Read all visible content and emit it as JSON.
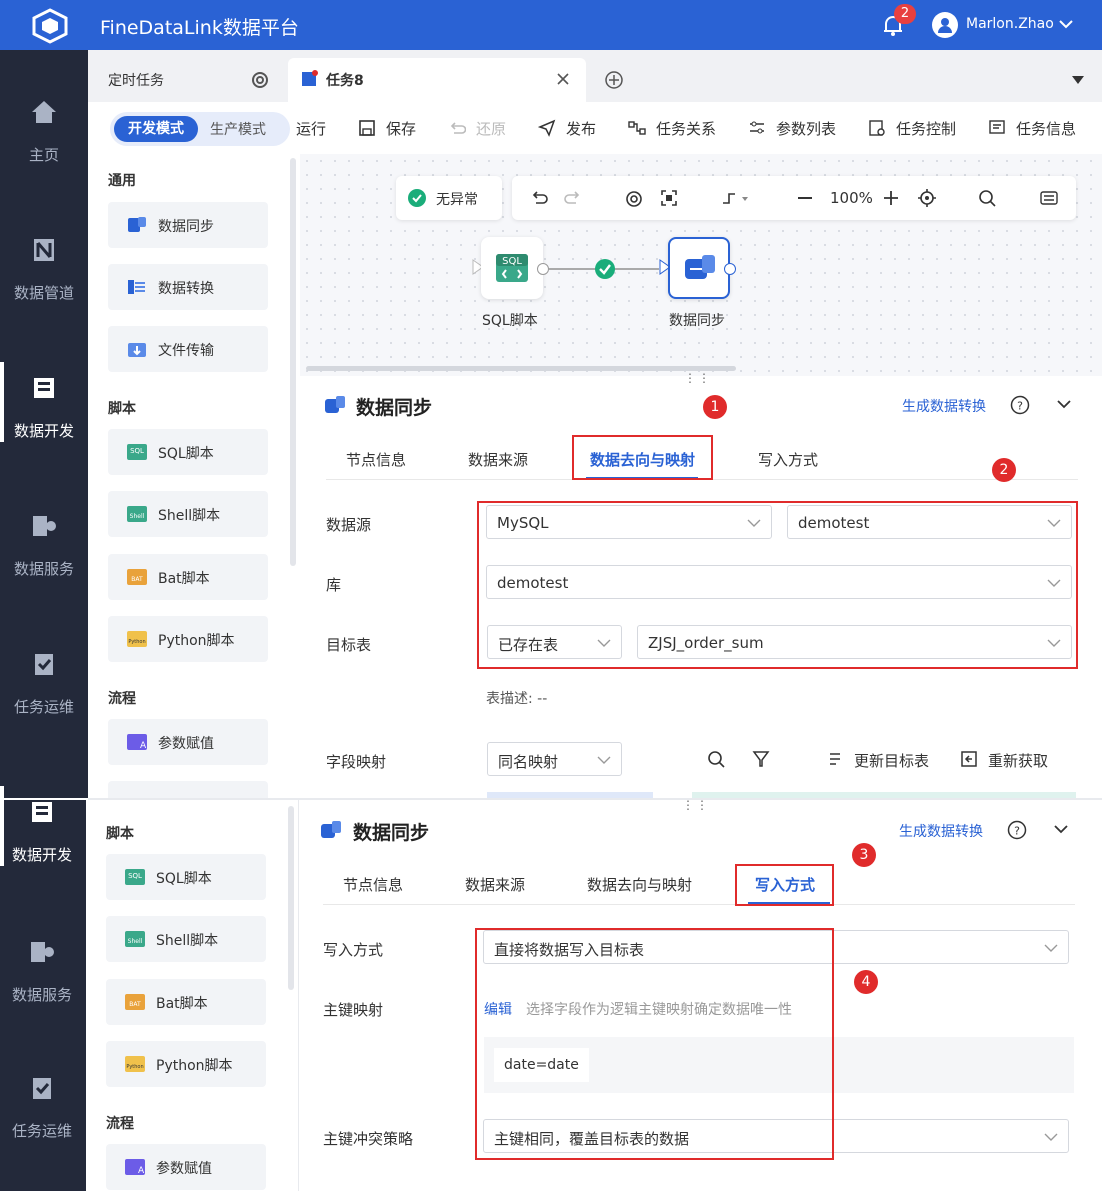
{
  "header": {
    "app_title": "FineDataLink数据平台",
    "notification_count": "2",
    "user_name": "Marlon.Zhao"
  },
  "sidebar_top": {
    "items": [
      {
        "label": "主页",
        "icon": "home-icon"
      },
      {
        "label": "数据管道",
        "icon": "pipeline-icon"
      },
      {
        "label": "数据开发",
        "icon": "dev-icon",
        "active": true
      },
      {
        "label": "数据服务",
        "icon": "service-icon"
      },
      {
        "label": "任务运维",
        "icon": "ops-icon"
      }
    ]
  },
  "sidebar_bottom": {
    "items": [
      {
        "label": "数据开发",
        "icon": "dev-icon",
        "active": true
      },
      {
        "label": "数据服务",
        "icon": "service-icon"
      },
      {
        "label": "任务运维",
        "icon": "ops-icon"
      }
    ]
  },
  "tabs": {
    "scheduled_tab": "定时任务",
    "task_tab": "任务8"
  },
  "toolbar": {
    "mode_dev": "开发模式",
    "mode_prod": "生产模式",
    "run": "运行",
    "save": "保存",
    "restore": "还原",
    "publish": "发布",
    "relations": "任务关系",
    "params": "参数列表",
    "control": "任务控制",
    "info": "任务信息"
  },
  "left_panel_top": {
    "sections": [
      {
        "title": "通用",
        "items": [
          "数据同步",
          "数据转换",
          "文件传输"
        ]
      },
      {
        "title": "脚本",
        "items": [
          "SQL脚本",
          "Shell脚本",
          "Bat脚本",
          "Python脚本"
        ]
      },
      {
        "title": "流程",
        "items": [
          "参数赋值"
        ]
      }
    ]
  },
  "left_panel_bottom": {
    "sections": [
      {
        "title": "脚本",
        "items": [
          "SQL脚本",
          "Shell脚本",
          "Bat脚本",
          "Python脚本"
        ]
      },
      {
        "title": "流程",
        "items": [
          "参数赋值"
        ]
      }
    ]
  },
  "canvas": {
    "status": "无异常",
    "zoom": "100%",
    "node_sql_label": "SQL脚本",
    "node_sync_label": "数据同步",
    "sql_badge": "SQL"
  },
  "panel1": {
    "title": "数据同步",
    "generate_link": "生成数据转换",
    "tabs": [
      "节点信息",
      "数据来源",
      "数据去向与映射",
      "写入方式"
    ],
    "active_tab": "数据去向与映射",
    "datasource_label": "数据源",
    "datasource_type": "MySQL",
    "datasource_conn": "demotest",
    "db_label": "库",
    "db_value": "demotest",
    "target_label": "目标表",
    "target_mode": "已存在表",
    "target_table": "ZJSJ_order_sum",
    "table_desc": "表描述: --",
    "mapping_label": "字段映射",
    "mapping_value": "同名映射",
    "update_target": "更新目标表",
    "refetch": "重新获取",
    "marker1": "1",
    "marker2": "2"
  },
  "panel2": {
    "title": "数据同步",
    "generate_link": "生成数据转换",
    "tabs": [
      "节点信息",
      "数据来源",
      "数据去向与映射",
      "写入方式"
    ],
    "active_tab": "写入方式",
    "write_mode_label": "写入方式",
    "write_mode_value": "直接将数据写入目标表",
    "pk_label": "主键映射",
    "pk_edit": "编辑",
    "pk_hint": "选择字段作为逻辑主键映射确定数据唯一性",
    "pk_value": "date=date",
    "conflict_label": "主键冲突策略",
    "conflict_value": "主键相同，覆盖目标表的数据",
    "marker3": "3",
    "marker4": "4"
  },
  "colors": {
    "primary": "#2a62d4",
    "sidebar": "#23293a",
    "highlight": "#e02b2b"
  }
}
